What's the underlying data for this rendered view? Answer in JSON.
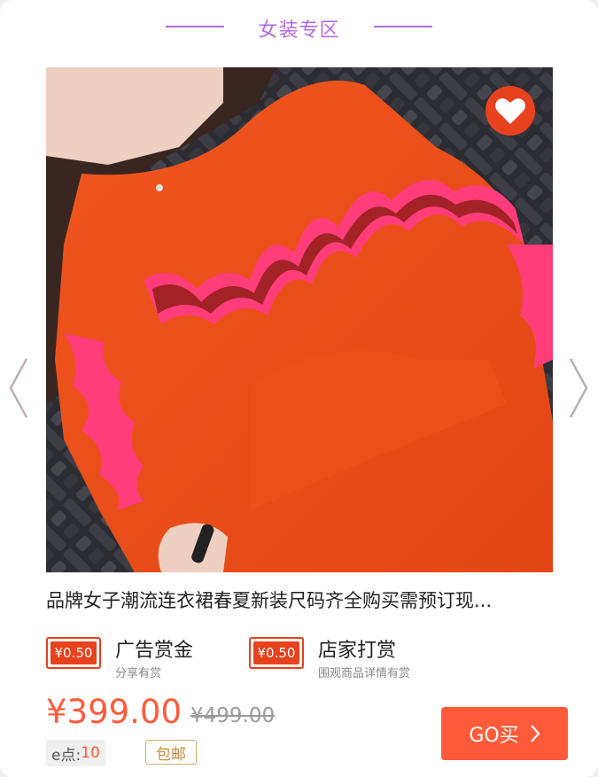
{
  "header": {
    "title": "女装专区"
  },
  "product": {
    "image_description_icon": "red-ruffle-sweater-photo",
    "favorite_icon": "heart-icon",
    "title": "品牌女子潮流连衣裙春夏新装尺码齐全购买需预订现...",
    "rewards": [
      {
        "badge": "¥0.50",
        "label": "广告赏金",
        "sub": "分享有赏"
      },
      {
        "badge": "¥0.50",
        "label": "店家打赏",
        "sub": "围观商品详情有赏"
      }
    ],
    "price": "¥399.00",
    "original_price": "¥499.00",
    "epoints_label": "e点:",
    "epoints_value": "10",
    "shipping_tag": "包邮",
    "buy_button": "GO买"
  },
  "colors": {
    "accent": "#ff5a3a",
    "header_purple": "#b46be0",
    "badge_red": "#e8411e"
  }
}
